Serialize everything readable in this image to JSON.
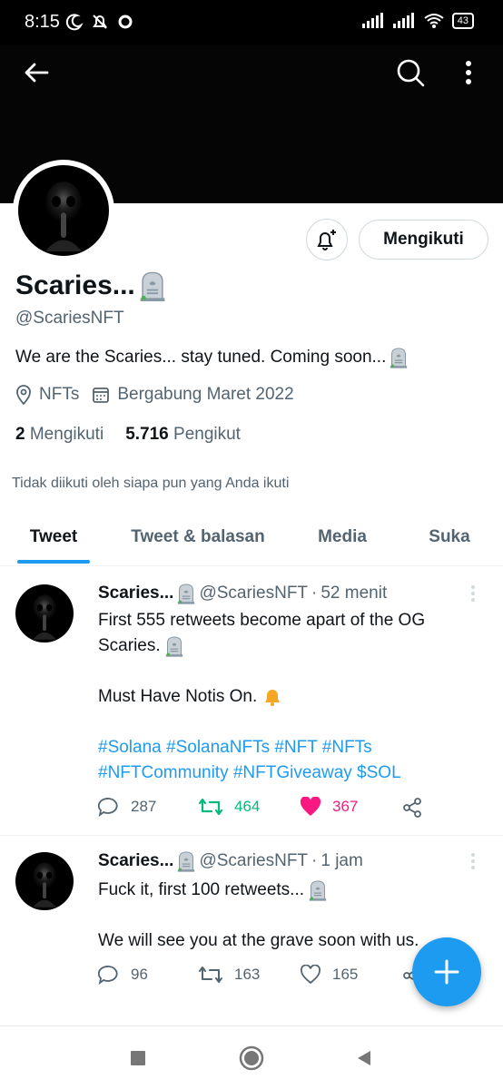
{
  "status_bar": {
    "time": "8:15",
    "battery": "43"
  },
  "profile": {
    "name": "Scaries...",
    "handle": "@ScariesNFT",
    "bio": "We are the Scaries... stay tuned. Coming soon...",
    "location": "NFTs",
    "joined": "Bergabung Maret 2022",
    "following_count": "2",
    "following_label": "Mengikuti",
    "followers_count": "5.716",
    "followers_label": "Pengikut",
    "follow_button": "Mengikuti",
    "followed_note": "Tidak diikuti oleh siapa pun yang Anda ikuti"
  },
  "tabs": [
    {
      "label": "Tweet"
    },
    {
      "label": "Tweet & balasan"
    },
    {
      "label": "Media"
    },
    {
      "label": "Suka"
    }
  ],
  "tweets": [
    {
      "name": "Scaries...",
      "handle": "@ScariesNFT",
      "separator": "·",
      "time": "52 menit",
      "line1": "First 555 retweets become apart of the OG",
      "line2": "Scaries.",
      "line3": "Must Have Notis On.",
      "hashtags1": "#Solana #SolanaNFTs #NFT #NFTs",
      "hashtags2": "#NFTCommunity #NFTGiveaway $SOL",
      "replies": "287",
      "retweets": "464",
      "likes": "367"
    },
    {
      "name": "Scaries...",
      "handle": "@ScariesNFT",
      "separator": "·",
      "time": "1 jam",
      "line1": "Fuck it, first 100 retweets...",
      "line2": "We will see you at the grave soon with us.",
      "replies": "96",
      "retweets": "163",
      "likes": "165"
    }
  ],
  "colors": {
    "accent": "#1d9bf0",
    "like": "#f91880",
    "retweet": "#00ba7c",
    "text": "#0f1419",
    "secondary": "#536471"
  }
}
